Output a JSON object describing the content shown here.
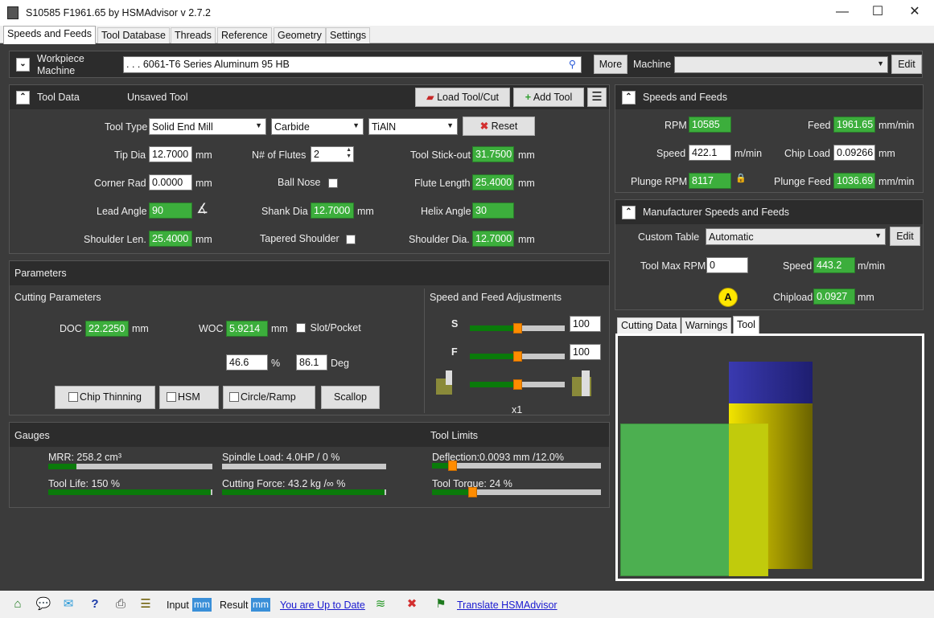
{
  "window": {
    "title": "S10585 F1961.65 by HSMAdvisor v 2.7.2",
    "minimize": "—",
    "maximize": "☐",
    "close": "✕"
  },
  "tabs": [
    "Speeds and Feeds",
    "Tool Database",
    "Threads",
    "Reference",
    "Geometry",
    "Settings"
  ],
  "workpiece": {
    "label1": "Workpiece",
    "label2": "Machine",
    "material": ". . . 6061-T6 Series Aluminum 95 HB",
    "more": "More",
    "machine_label": "Machine",
    "machine_value": "",
    "edit": "Edit"
  },
  "tool_data": {
    "header": "Tool Data",
    "status": "Unsaved Tool",
    "load": "Load Tool/Cut",
    "add": "Add Tool",
    "tool_type_label": "Tool Type",
    "tool_type": "Solid End Mill",
    "material": "Carbide",
    "coating": "TiAlN",
    "reset": "Reset",
    "tip_dia_label": "Tip Dia",
    "tip_dia": "12.7000",
    "tip_dia_unit": "mm",
    "flutes_label": "N# of Flutes",
    "flutes": "2",
    "stickout_label": "Tool Stick-out",
    "stickout": "31.7500",
    "stickout_unit": "mm",
    "corner_label": "Corner Rad",
    "corner": "0.0000",
    "corner_unit": "mm",
    "ballnose_label": "Ball Nose",
    "flute_len_label": "Flute Length",
    "flute_len": "25.4000",
    "flute_len_unit": "mm",
    "lead_label": "Lead Angle",
    "lead": "90",
    "shank_label": "Shank Dia",
    "shank": "12.7000",
    "shank_unit": "mm",
    "helix_label": "Helix Angle",
    "helix": "30",
    "shoulder_len_label": "Shoulder Len.",
    "shoulder_len": "25.4000",
    "shoulder_len_unit": "mm",
    "tapered_label": "Tapered Shoulder",
    "shoulder_dia_label": "Shoulder Dia.",
    "shoulder_dia": "12.7000",
    "shoulder_dia_unit": "mm"
  },
  "parameters": {
    "header": "Parameters",
    "cutting_header": "Cutting Parameters",
    "doc_label": "DOC",
    "doc": "22.2250",
    "doc_unit": "mm",
    "woc_label": "WOC",
    "woc": "5.9214",
    "woc_unit": "mm",
    "slot_label": "Slot/Pocket",
    "pct": "46.6",
    "pct_unit": "%",
    "deg": "86.1",
    "deg_unit": "Deg",
    "chip_thinning": "Chip Thinning",
    "hsm": "HSM",
    "circle": "Circle/Ramp",
    "scallop": "Scallop",
    "adj_header": "Speed and Feed Adjustments",
    "s_label": "S",
    "s_value": "100",
    "f_label": "F",
    "f_value": "100",
    "x_label": "x1",
    "s_level": 0.5,
    "f_level": 0.5,
    "x_level": 0.5
  },
  "gauges": {
    "header": "Gauges",
    "limits_header": "Tool Limits",
    "mrr": "MRR: 258.2 cm³",
    "mrr_level": 0.17,
    "spindle": "Spindle Load: 4.0HP / 0 %",
    "spindle_level": 0.0,
    "life": "Tool Life: 150 %",
    "life_level": 0.99,
    "force": "Cutting Force: 43.2 kg /∞ %",
    "force_level": 0.99,
    "deflection": "Deflection:0.0093 mm /12.0%",
    "deflection_level": 0.12,
    "torque": "Tool Torque: 24 %",
    "torque_level": 0.24
  },
  "speeds": {
    "header": "Speeds and Feeds",
    "rpm_label": "RPM",
    "rpm": "10585",
    "feed_label": "Feed",
    "feed": "1961.65",
    "feed_unit": "mm/min",
    "speed_label": "Speed",
    "speed": "422.1",
    "speed_unit": "m/min",
    "chipload_label": "Chip Load",
    "chipload": "0.09266",
    "chipload_unit": "mm",
    "plunge_rpm_label": "Plunge RPM",
    "plunge_rpm": "8117",
    "plunge_feed_label": "Plunge Feed",
    "plunge_feed": "1036.69",
    "plunge_feed_unit": "mm/min"
  },
  "manufacturer": {
    "header": "Manufacturer Speeds and Feeds",
    "custom_label": "Custom Table",
    "custom": "Automatic",
    "edit": "Edit",
    "max_rpm_label": "Tool Max RPM",
    "max_rpm": "0",
    "speed_label": "Speed",
    "speed": "443.2",
    "speed_unit": "m/min",
    "badge": "A",
    "chipload_label": "Chipload",
    "chipload": "0.0927",
    "chipload_unit": "mm"
  },
  "viewtabs": [
    "Cutting Data",
    "Warnings",
    "Tool"
  ],
  "status": {
    "input_label": "Input",
    "input_unit": "mm",
    "result_label": "Result",
    "result_unit": "mm",
    "uptodate": "You are Up to Date",
    "translate": "Translate HSMAdvisor"
  },
  "colors": {
    "accent_green": "#3cae3c",
    "bar_green": "#0a7a0a",
    "thumb_orange": "#ff8c00",
    "tool_yellow": "#e6d800",
    "tool_blue": "#2a2a9a",
    "stock_green": "#4caf50"
  }
}
